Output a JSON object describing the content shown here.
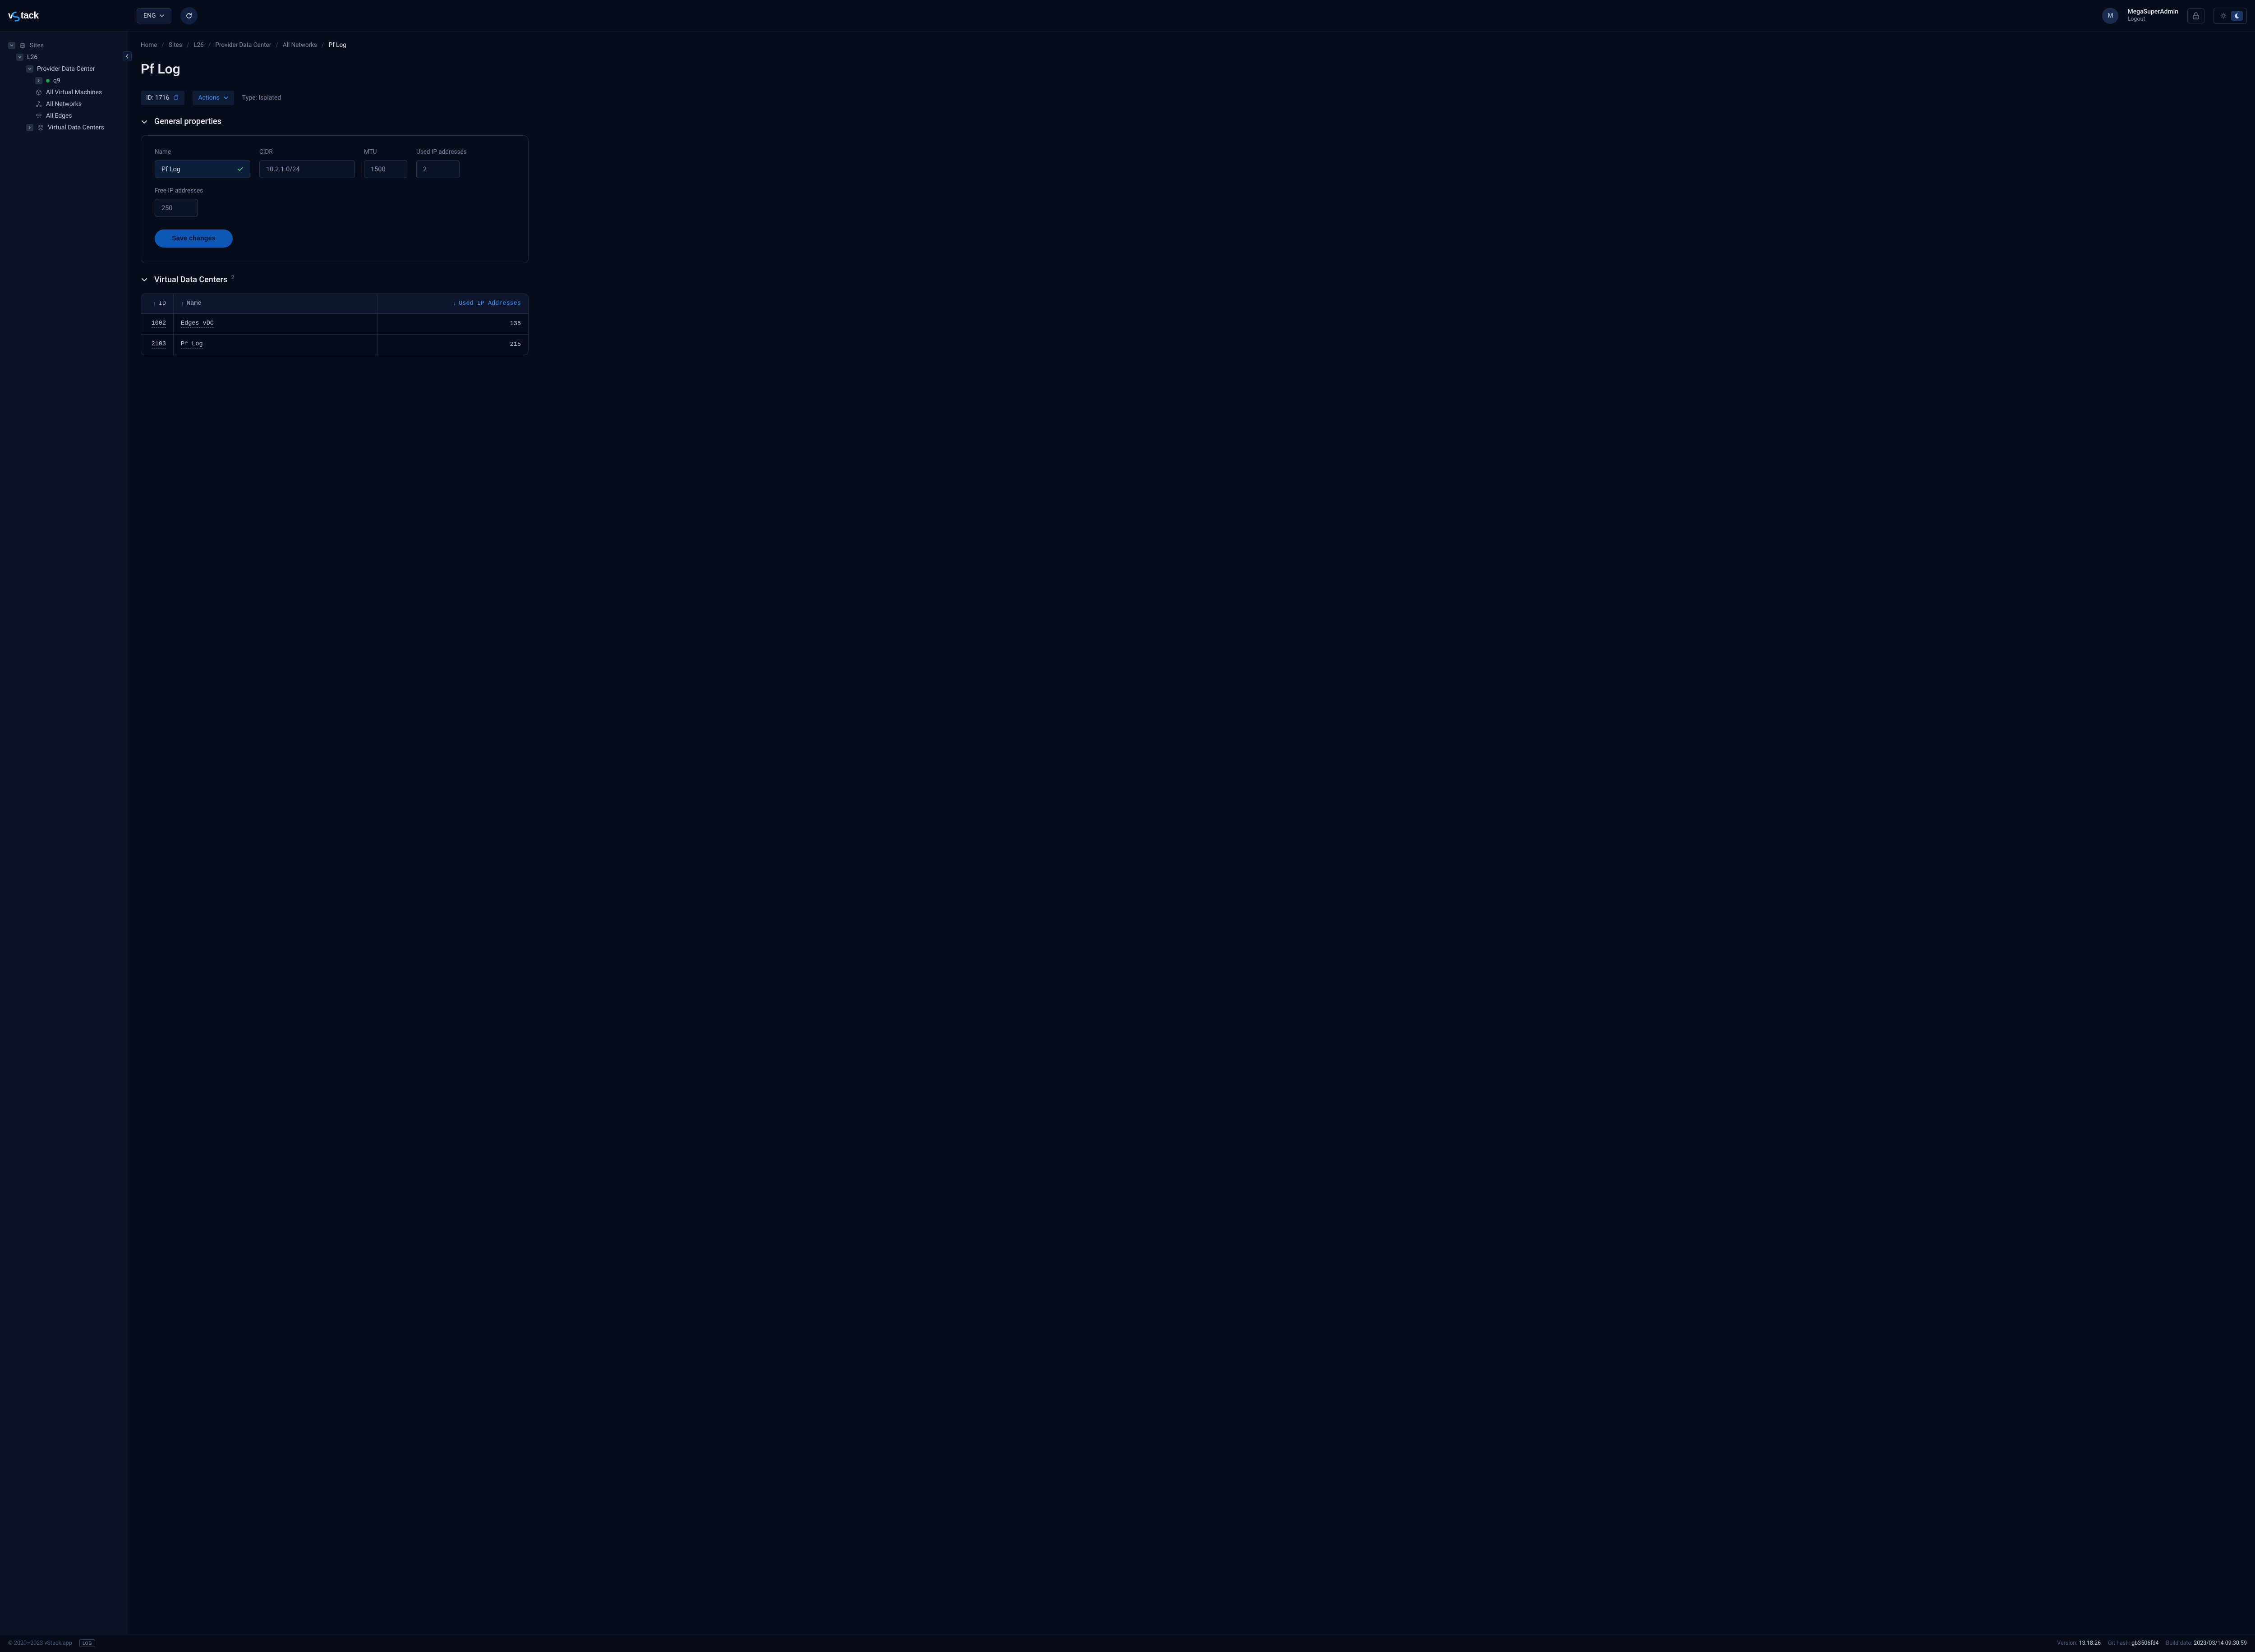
{
  "header": {
    "logo_text": "vStack",
    "language": "ENG",
    "user_initial": "M",
    "user_name": "MegaSuperAdmin",
    "logout_label": "Logout"
  },
  "sidebar": {
    "root": "Sites",
    "site": "L26",
    "datacenter": "Provider Data Center",
    "cluster": "q9",
    "all_vms": "All Virtual Machines",
    "all_networks": "All Networks",
    "all_edges": "All Edges",
    "vdcs": "Virtual Data Centers"
  },
  "breadcrumb": {
    "home": "Home",
    "sites": "Sites",
    "site": "L26",
    "dc": "Provider Data Center",
    "nets": "All Networks",
    "current": "Pf Log"
  },
  "page": {
    "title": "Pf Log",
    "id_label": "ID: 1716",
    "actions_label": "Actions",
    "type_label": "Type: Isolated"
  },
  "sections": {
    "general": "General properties",
    "vdc": "Virtual Data Centers",
    "vdc_count": "2"
  },
  "form": {
    "name_label": "Name",
    "name_value": "Pf Log",
    "cidr_label": "CIDR",
    "cidr_value": "10.2.1.0/24",
    "mtu_label": "MTU",
    "mtu_value": "1500",
    "used_label": "Used IP addresses",
    "used_value": "2",
    "free_label": "Free IP addresses",
    "free_value": "250",
    "save_label": "Save changes"
  },
  "table": {
    "col_id": "ID",
    "col_name": "Name",
    "col_used": "Used IP Addresses",
    "rows": [
      {
        "id": "1002",
        "name": "Edges vDC",
        "used": "135"
      },
      {
        "id": "2103",
        "name": "Pf Log",
        "used": "215"
      }
    ]
  },
  "footer": {
    "copyright": "© 2020–2023 vStack.app",
    "log_badge": "LOG",
    "version_label": "Version:",
    "version": "13.18.26",
    "githash_label": "Git hash:",
    "githash": "gb3506fd4",
    "build_label": "Build date:",
    "build": "2023/03/14 09:30:59"
  }
}
